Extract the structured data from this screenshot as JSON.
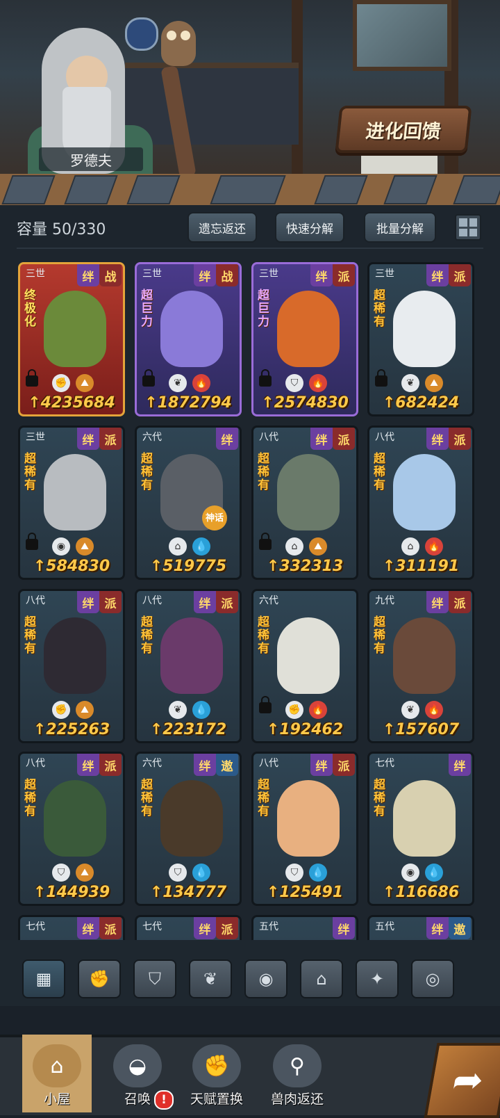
{
  "header": {
    "npc_name": "罗德夫",
    "evolve_feedback_label": "进化回馈"
  },
  "inventory": {
    "capacity_label": "容量 50/330",
    "buttons": {
      "forget_return": "遗忘返还",
      "quick_decompose": "快速分解",
      "batch_decompose": "批量分解"
    }
  },
  "cards": [
    {
      "gen": "三世",
      "tag1": "绊",
      "tag2": "战",
      "rarity": "终极化",
      "power": "4235684",
      "locked": true,
      "icons": [
        "fist",
        "earth"
      ],
      "style": "red",
      "art": "#6b8a3a"
    },
    {
      "gen": "三世",
      "tag1": "绊",
      "tag2": "战",
      "rarity": "超巨力",
      "power": "1872794",
      "locked": true,
      "icons": [
        "leaf",
        "fire"
      ],
      "style": "purple",
      "art": "#8a7ad8"
    },
    {
      "gen": "三世",
      "tag1": "绊",
      "tag2": "派",
      "rarity": "超巨力",
      "power": "2574830",
      "locked": true,
      "icons": [
        "shield",
        "fire"
      ],
      "style": "purple",
      "art": "#d86a2a"
    },
    {
      "gen": "三世",
      "tag1": "绊",
      "tag2": "派",
      "rarity": "超稀有",
      "power": "682424",
      "locked": true,
      "icons": [
        "leaf",
        "earth"
      ],
      "style": "normal",
      "art": "#e8ecef"
    },
    {
      "gen": "三世",
      "tag1": "绊",
      "tag2": "派",
      "rarity": "超稀有",
      "power": "584830",
      "locked": true,
      "icons": [
        "alien",
        "earth"
      ],
      "style": "normal",
      "art": "#b8bcc0"
    },
    {
      "gen": "六代",
      "tag1": "绊",
      "tag2": "",
      "rarity": "超稀有",
      "power": "519775",
      "locked": false,
      "icons": [
        "tower",
        "water"
      ],
      "style": "normal",
      "art": "#5a5f66",
      "myth": "神话"
    },
    {
      "gen": "八代",
      "tag1": "绊",
      "tag2": "派",
      "rarity": "超稀有",
      "power": "332313",
      "locked": true,
      "icons": [
        "tower",
        "earth"
      ],
      "style": "normal",
      "art": "#6a7a6a"
    },
    {
      "gen": "八代",
      "tag1": "绊",
      "tag2": "派",
      "rarity": "超稀有",
      "power": "311191",
      "locked": false,
      "icons": [
        "tower",
        "fire"
      ],
      "style": "normal",
      "art": "#a8c8e8"
    },
    {
      "gen": "八代",
      "tag1": "绊",
      "tag2": "派",
      "rarity": "超稀有",
      "power": "225263",
      "locked": false,
      "icons": [
        "fist",
        "earth"
      ],
      "style": "normal",
      "art": "#2e2a33"
    },
    {
      "gen": "八代",
      "tag1": "绊",
      "tag2": "派",
      "rarity": "超稀有",
      "power": "223172",
      "locked": false,
      "icons": [
        "leaf",
        "water"
      ],
      "style": "normal",
      "art": "#6a3a6a"
    },
    {
      "gen": "六代",
      "tag1": "",
      "tag2": "",
      "rarity": "超稀有",
      "power": "192462",
      "locked": true,
      "icons": [
        "fist",
        "fire"
      ],
      "style": "normal",
      "art": "#e0e0d8"
    },
    {
      "gen": "九代",
      "tag1": "绊",
      "tag2": "派",
      "rarity": "超稀有",
      "power": "157607",
      "locked": false,
      "icons": [
        "leaf",
        "fire"
      ],
      "style": "normal",
      "art": "#6a4a3a"
    },
    {
      "gen": "八代",
      "tag1": "绊",
      "tag2": "派",
      "rarity": "超稀有",
      "power": "144939",
      "locked": false,
      "icons": [
        "shield",
        "earth"
      ],
      "style": "normal",
      "art": "#3a5a3a"
    },
    {
      "gen": "六代",
      "tag1": "绊",
      "tag2": "遨",
      "rarity": "超稀有",
      "power": "134777",
      "locked": false,
      "icons": [
        "shield",
        "water"
      ],
      "style": "normal",
      "art": "#4a3a2a"
    },
    {
      "gen": "八代",
      "tag1": "绊",
      "tag2": "派",
      "rarity": "超稀有",
      "power": "125491",
      "locked": false,
      "icons": [
        "shield",
        "water"
      ],
      "style": "normal",
      "art": "#e8b080"
    },
    {
      "gen": "七代",
      "tag1": "绊",
      "tag2": "",
      "rarity": "超稀有",
      "power": "116686",
      "locked": false,
      "icons": [
        "alien",
        "water"
      ],
      "style": "normal",
      "art": "#d8d0b0"
    },
    {
      "gen": "七代",
      "tag1": "绊",
      "tag2": "派",
      "rarity": "",
      "power": "",
      "locked": false,
      "icons": [],
      "style": "normal",
      "art": ""
    },
    {
      "gen": "七代",
      "tag1": "绊",
      "tag2": "派",
      "rarity": "",
      "power": "",
      "locked": false,
      "icons": [],
      "style": "normal",
      "art": ""
    },
    {
      "gen": "五代",
      "tag1": "绊",
      "tag2": "",
      "rarity": "",
      "power": "",
      "locked": false,
      "icons": [],
      "style": "normal",
      "art": ""
    },
    {
      "gen": "五代",
      "tag1": "绊",
      "tag2": "遨",
      "rarity": "",
      "power": "",
      "locked": false,
      "icons": [],
      "style": "normal",
      "art": ""
    }
  ],
  "filters": [
    {
      "name": "all",
      "glyph": "▦",
      "active": true
    },
    {
      "name": "fist",
      "glyph": "✊",
      "active": false
    },
    {
      "name": "shield",
      "glyph": "⛉",
      "active": false
    },
    {
      "name": "leaf",
      "glyph": "❦",
      "active": false
    },
    {
      "name": "alien",
      "glyph": "◉",
      "active": false
    },
    {
      "name": "tower",
      "glyph": "⌂",
      "active": false
    },
    {
      "name": "crosshair",
      "glyph": "✦",
      "active": false
    },
    {
      "name": "swirl",
      "glyph": "◎",
      "active": false
    }
  ],
  "nav": [
    {
      "label": "小屋",
      "glyph": "⌂",
      "active": true
    },
    {
      "label": "召唤",
      "glyph": "◒",
      "active": false
    },
    {
      "label": "天赋置换",
      "glyph": "✊",
      "active": false
    },
    {
      "label": "兽肉返还",
      "glyph": "⚲",
      "active": false
    }
  ],
  "nav_badge": "!",
  "icon_glyphs": {
    "fist": "✊",
    "leaf": "❦",
    "shield": "⛉",
    "alien": "◉",
    "tower": "⌂",
    "fire": "🔥",
    "water": "💧",
    "earth": "⛰"
  }
}
